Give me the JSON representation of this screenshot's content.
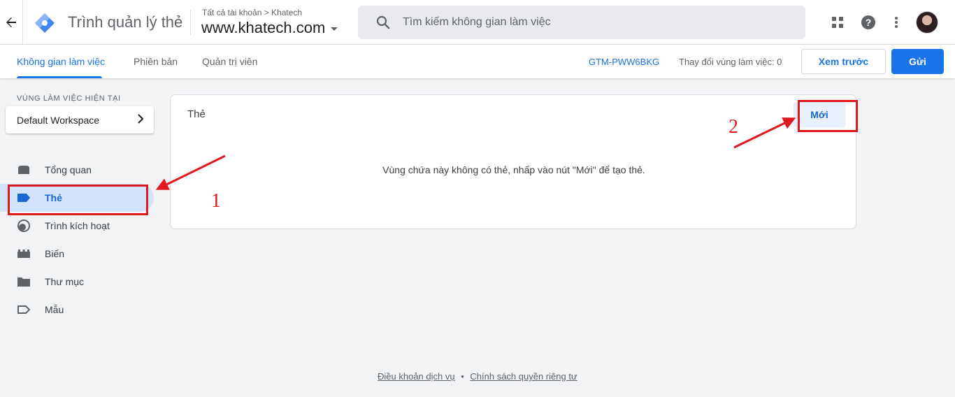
{
  "header": {
    "back_icon": "arrow-left-icon",
    "app_title": "Trình quản lý thẻ",
    "breadcrumb": "Tất cả tài khoản > Khatech",
    "container_name": "www.khatech.com",
    "search_placeholder": "Tìm kiếm không gian làm việc",
    "icons": [
      "apps-grid-icon",
      "help-icon",
      "more-vert-icon",
      "avatar"
    ]
  },
  "tabs": {
    "items": [
      {
        "label": "Không gian làm việc",
        "active": true
      },
      {
        "label": "Phiên bản",
        "active": false
      },
      {
        "label": "Quản trị viên",
        "active": false
      }
    ],
    "container_id": "GTM-PWW6BKG",
    "workspace_changes": "Thay đổi vùng làm việc: 0",
    "preview_label": "Xem trước",
    "submit_label": "Gửi"
  },
  "sidebar": {
    "workspace_heading": "VÙNG LÀM VIỆC HIỆN TẠI",
    "workspace_name": "Default Workspace",
    "items": [
      {
        "label": "Tổng quan",
        "icon": "overview-icon",
        "active": false
      },
      {
        "label": "Thẻ",
        "icon": "tag-icon",
        "active": true
      },
      {
        "label": "Trình kích hoạt",
        "icon": "trigger-icon",
        "active": false
      },
      {
        "label": "Biến",
        "icon": "variable-icon",
        "active": false
      },
      {
        "label": "Thư mục",
        "icon": "folder-icon",
        "active": false
      },
      {
        "label": "Mẫu",
        "icon": "template-icon",
        "active": false
      }
    ]
  },
  "main": {
    "card_title": "Thẻ",
    "new_button": "Mới",
    "empty_message": "Vùng chứa này không có thẻ, nhấp vào nút \"Mới\" để tạo thẻ."
  },
  "annotations": {
    "step1": "1",
    "step2": "2",
    "color": "#e0191c"
  },
  "footer": {
    "terms": "Điều khoản dịch vụ",
    "separator": "•",
    "privacy": "Chính sách quyền riêng tư"
  },
  "colors": {
    "accent": "#1a73e8",
    "active_bg": "#d2e3fc",
    "page_bg": "#f1f3f4"
  }
}
